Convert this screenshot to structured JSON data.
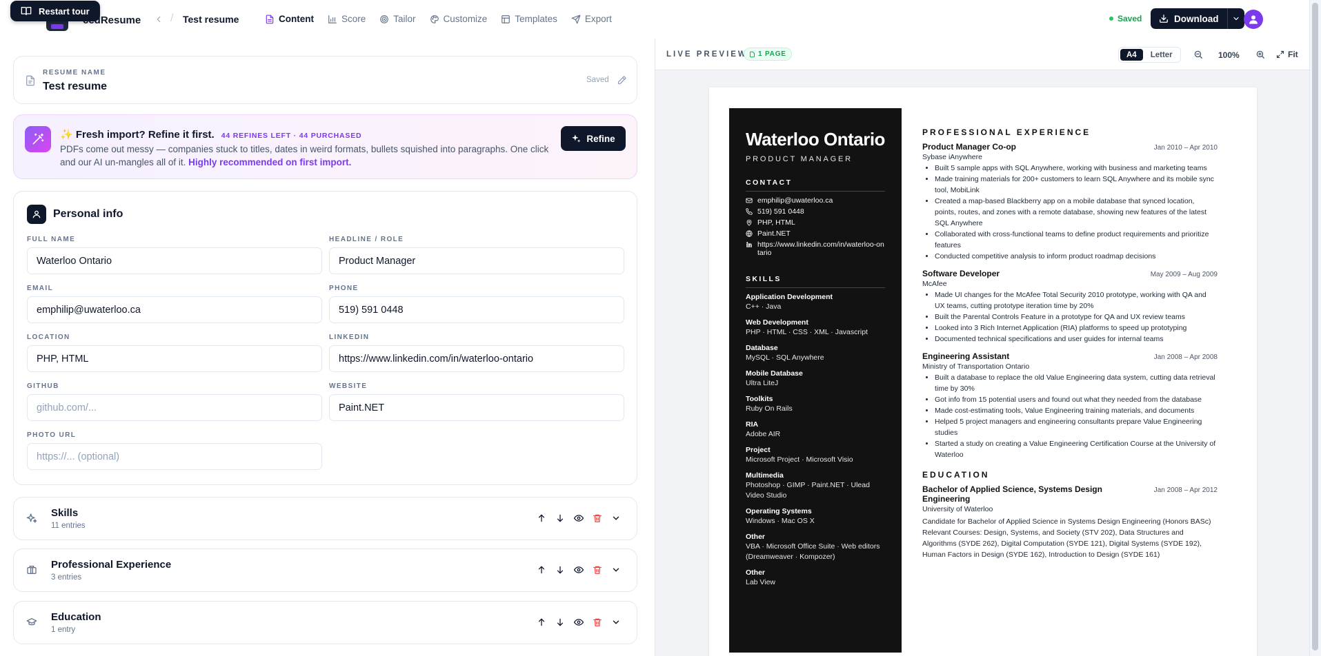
{
  "header": {
    "tour_label": "Restart tour",
    "brand": "cedResume",
    "doc_title": "Test resume",
    "tabs": [
      {
        "label": "Content",
        "icon": "file-text-icon"
      },
      {
        "label": "Score",
        "icon": "bar-chart-icon"
      },
      {
        "label": "Tailor",
        "icon": "target-icon"
      },
      {
        "label": "Customize",
        "icon": "palette-icon"
      },
      {
        "label": "Templates",
        "icon": "layout-icon"
      },
      {
        "label": "Export",
        "icon": "send-icon"
      }
    ],
    "saved_label": "Saved",
    "download_label": "Download"
  },
  "name_card": {
    "label": "RESUME NAME",
    "value": "Test resume",
    "saved": "Saved"
  },
  "refine": {
    "title": "✨ Fresh import? Refine it first.",
    "counter": "44 REFINES LEFT · 44 PURCHASED",
    "body": "PDFs come out messy — companies stuck to titles, dates in weird formats, bullets squished into paragraphs. One click and our AI un-mangles all of it.",
    "link": "Highly recommended on first import.",
    "button": "Refine"
  },
  "personal": {
    "title": "Personal info",
    "fields": {
      "full_name": {
        "label": "FULL NAME",
        "value": "Waterloo Ontario"
      },
      "headline": {
        "label": "HEADLINE / ROLE",
        "value": "Product Manager"
      },
      "email": {
        "label": "EMAIL",
        "value": "emphilip@uwaterloo.ca"
      },
      "phone": {
        "label": "PHONE",
        "value": "519) 591 0448"
      },
      "location": {
        "label": "LOCATION",
        "value": "PHP, HTML"
      },
      "linkedin": {
        "label": "LINKEDIN",
        "value": "https://www.linkedin.com/in/waterloo-ontario"
      },
      "github": {
        "label": "GITHUB",
        "placeholder": "github.com/..."
      },
      "website": {
        "label": "WEBSITE",
        "value": "Paint.NET"
      },
      "photo": {
        "label": "PHOTO URL",
        "placeholder": "https://... (optional)"
      }
    }
  },
  "sections": [
    {
      "title": "Skills",
      "count": "11 entries",
      "icon": "sparkles-icon"
    },
    {
      "title": "Professional Experience",
      "count": "3 entries",
      "icon": "briefcase-icon"
    },
    {
      "title": "Education",
      "count": "1 entry",
      "icon": "graduation-cap-icon"
    }
  ],
  "preview": {
    "label": "LIVE PREVIEW",
    "pages": "1 PAGE",
    "sizes": [
      "A4",
      "Letter"
    ],
    "selected_size": "A4",
    "zoom": "100%",
    "fit": "Fit"
  },
  "resume": {
    "name": "Waterloo Ontario",
    "role": "PRODUCT MANAGER",
    "contact_heading": "CONTACT",
    "contact": [
      {
        "icon": "mail-icon",
        "text": "emphilip@uwaterloo.ca"
      },
      {
        "icon": "phone-icon",
        "text": "519) 591 0448"
      },
      {
        "icon": "location-pin-icon",
        "text": "PHP, HTML"
      },
      {
        "icon": "globe-icon",
        "text": "Paint.NET"
      },
      {
        "icon": "linkedin-icon",
        "text": "https://www.linkedin.com/in/waterloo-ontario"
      }
    ],
    "skills_heading": "SKILLS",
    "skills": [
      {
        "category": "Application Development",
        "items": "C++ · Java"
      },
      {
        "category": "Web Development",
        "items": "PHP · HTML · CSS · XML · Javascript"
      },
      {
        "category": "Database",
        "items": "MySQL · SQL Anywhere"
      },
      {
        "category": "Mobile Database",
        "items": "Ultra LiteJ"
      },
      {
        "category": "Toolkits",
        "items": "Ruby On Rails"
      },
      {
        "category": "RIA",
        "items": "Adobe AIR"
      },
      {
        "category": "Project",
        "items": "Microsoft Project · Microsoft Visio"
      },
      {
        "category": "Multimedia",
        "items": "Photoshop · GIMP · Paint.NET · Ulead Video Studio"
      },
      {
        "category": "Operating Systems",
        "items": "Windows · Mac OS X"
      },
      {
        "category": "Other",
        "items": "VBA · Microsoft Office Suite · Web editors (Dreamweaver · Kompozer)"
      },
      {
        "category": "Other",
        "items": "Lab View"
      }
    ],
    "experience_heading": "PROFESSIONAL EXPERIENCE",
    "jobs": [
      {
        "title": "Product Manager Co-op",
        "dates": "Jan 2010 – Apr 2010",
        "company": "Sybase iAnywhere",
        "bullets": [
          "Built 5 sample apps with SQL Anywhere, working with business and marketing teams",
          "Made training materials for 200+ customers to learn SQL Anywhere and its mobile sync tool, MobiLink",
          "Created a map-based Blackberry app on a mobile database that synced location, points, routes, and zones with a remote database, showing new features of the latest SQL Anywhere",
          "Collaborated with cross-functional teams to define product requirements and prioritize features",
          "Conducted competitive analysis to inform product roadmap decisions"
        ]
      },
      {
        "title": "Software Developer",
        "dates": "May 2009 – Aug 2009",
        "company": "McAfee",
        "bullets": [
          "Made UI changes for the McAfee Total Security 2010 prototype, working with QA and UX teams, cutting prototype iteration time by 20%",
          "Built the Parental Controls Feature in a prototype for QA and UX review teams",
          "Looked into 3 Rich Internet Application (RIA) platforms to speed up prototyping",
          "Documented technical specifications and user guides for internal teams"
        ]
      },
      {
        "title": "Engineering Assistant",
        "dates": "Jan 2008 – Apr 2008",
        "company": "Ministry of Transportation Ontario",
        "bullets": [
          "Built a database to replace the old Value Engineering data system, cutting data retrieval time by 30%",
          "Got info from 15 potential users and found out what they needed from the database",
          "Made cost-estimating tools, Value Engineering training materials, and documents",
          "Helped 5 project managers and engineering consultants prepare Value Engineering studies",
          "Started a study on creating a Value Engineering Certification Course at the University of Waterloo"
        ]
      }
    ],
    "education_heading": "EDUCATION",
    "education": {
      "degree": "Bachelor of Applied Science, Systems Design Engineering",
      "dates": "Jan 2008 – Apr 2012",
      "school": "University of Waterloo",
      "description": "Candidate for Bachelor of Applied Science in Systems Design Engineering (Honors BASc) Relevant Courses: Design, Systems, and Society (STV 202), Data Structures and Algorithms (SYDE 262), Digital Computation (SYDE 121), Digital Systems (SYDE 192), Human Factors in Design (SYDE 162), Introduction to Design (SYDE 161)"
    }
  },
  "colors": {
    "accent": "#7c3aed",
    "dark": "#0f172a",
    "success": "#16a34a",
    "danger": "#ef4444"
  }
}
